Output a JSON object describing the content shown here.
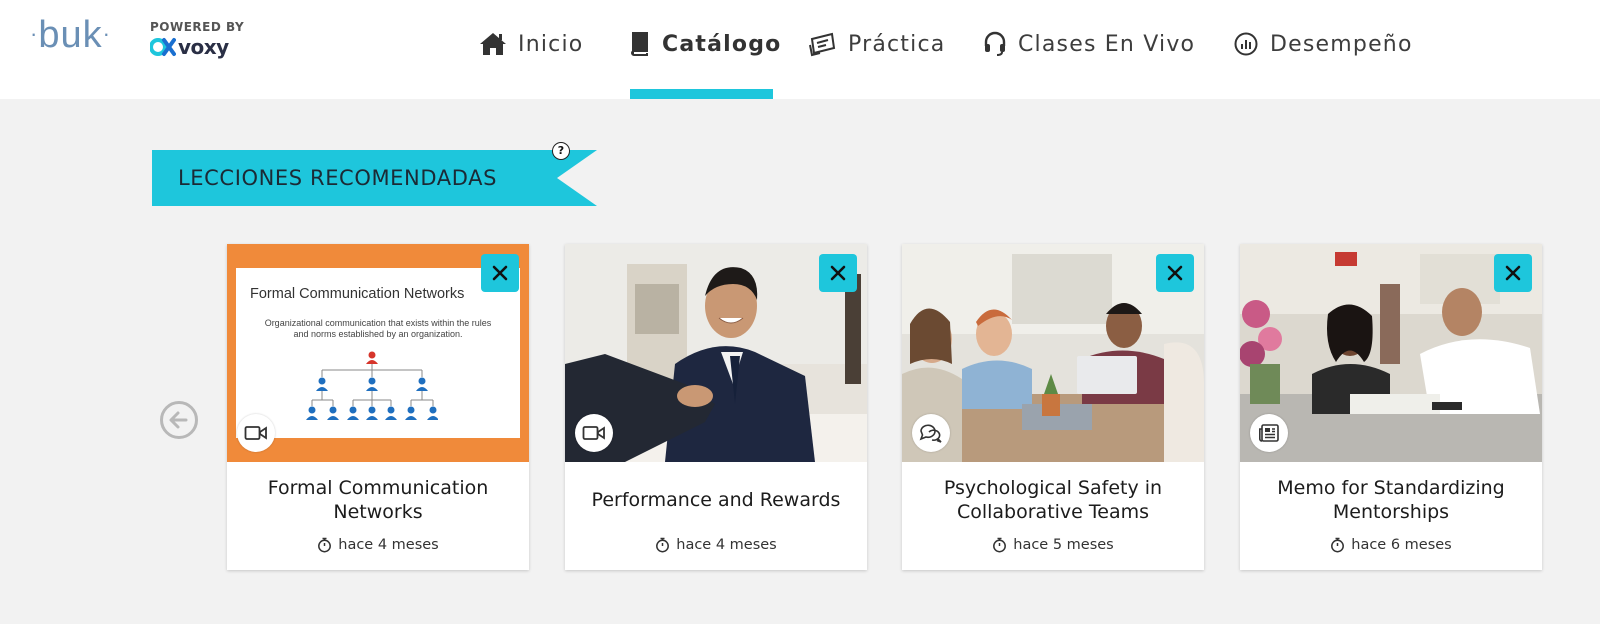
{
  "branding": {
    "logo_text": "buk",
    "powered_by": "POWERED BY",
    "partner_name": "voxy"
  },
  "nav": {
    "items": [
      {
        "label": "Inicio",
        "icon": "home-icon"
      },
      {
        "label": "Catálogo",
        "icon": "book-icon",
        "active": true
      },
      {
        "label": "Práctica",
        "icon": "practice-icon"
      },
      {
        "label": "Clases En Vivo",
        "icon": "headset-icon"
      },
      {
        "label": "Desempeño",
        "icon": "chart-icon"
      }
    ]
  },
  "section": {
    "title": "LECCIONES RECOMENDADAS",
    "help": "?"
  },
  "colors": {
    "accent": "#1ec6dc",
    "slide_orange": "#f08a3a",
    "people_blue": "#1f6fbf",
    "people_red": "#d6352b"
  },
  "cards": [
    {
      "title": "Formal Communication Networks",
      "time": "hace 4 meses",
      "type_icon": "video-icon",
      "slide_title": "Formal Communication Networks",
      "slide_subtitle": "Organizational communication that exists within the rules and norms established by an organization."
    },
    {
      "title": "Performance and Rewards",
      "time": "hace 4 meses",
      "type_icon": "video-icon"
    },
    {
      "title": "Psychological Safety in Collaborative Teams",
      "time": "hace 5 meses",
      "type_icon": "chat-icon"
    },
    {
      "title": "Memo for Standardizing Mentorships",
      "time": "hace 6 meses",
      "type_icon": "document-icon"
    }
  ]
}
